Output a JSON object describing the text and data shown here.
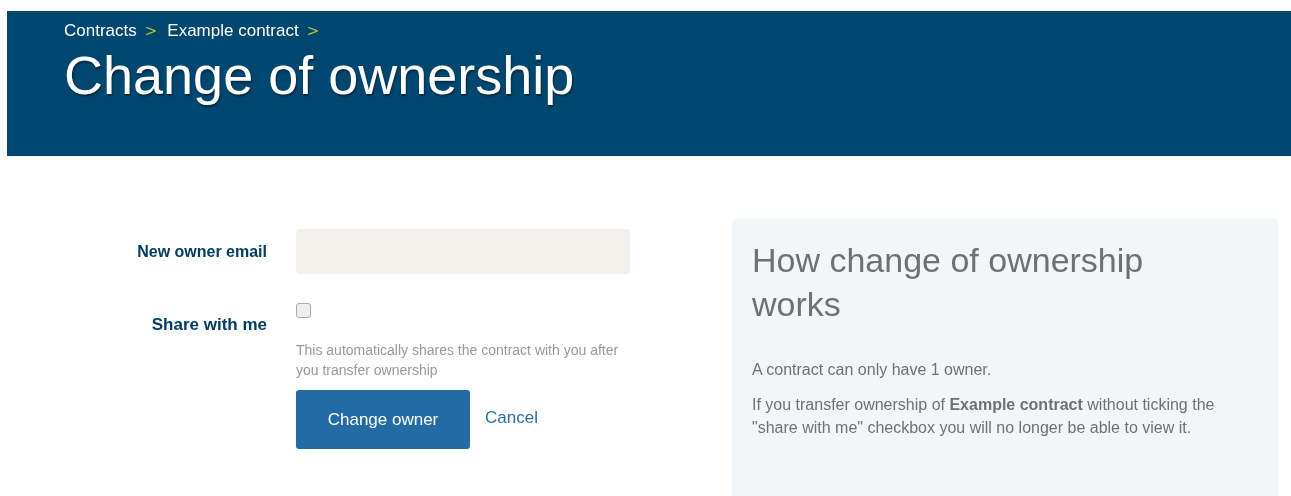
{
  "breadcrumbs": [
    {
      "label": "Contracts",
      "separator": ">"
    },
    {
      "label": "Example contract",
      "separator": ">"
    }
  ],
  "title": "Change of ownership",
  "form": {
    "email_label": "New owner email",
    "share_label": "Share with me",
    "share_checked": false,
    "share_hint": "This automatically shares the contract with you after you transfer ownership",
    "submit": "Change owner",
    "cancel": "Cancel"
  },
  "info": {
    "heading": "How change of ownership works",
    "paragraphs": [
      "A contract can only have 1 owner.",
      "If you transfer ownership of **Example contract** without ticking the \"share with me\" checkbox you will no longer be able to view it."
    ]
  }
}
